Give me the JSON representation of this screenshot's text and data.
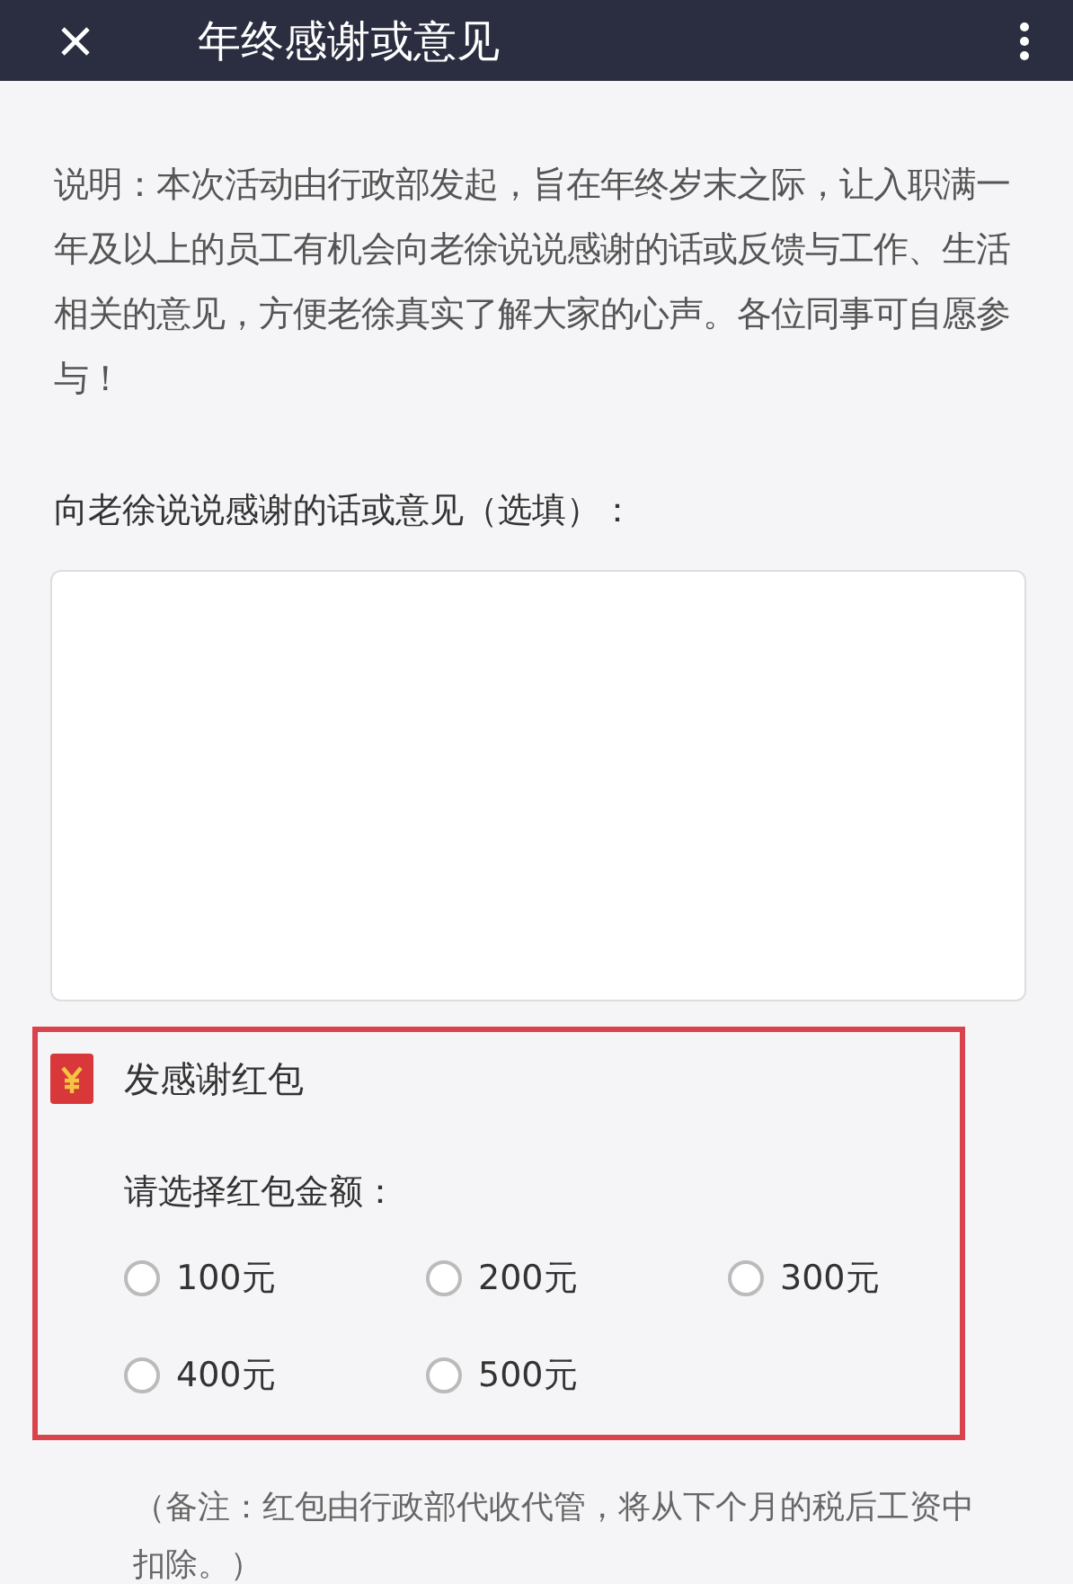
{
  "header": {
    "title": "年终感谢或意见"
  },
  "description": "说明：本次活动由行政部发起，旨在年终岁末之际，让入职满一年及以上的员工有机会向老徐说说感谢的话或反馈与工作、生活相关的意见，方便老徐真实了解大家的心声。各位同事可自愿参与！",
  "comment": {
    "label": "向老徐说说感谢的话或意见（选填）："
  },
  "red_packet": {
    "label": "发感谢红包",
    "prompt": "请选择红包金额：",
    "options": [
      {
        "label": "100元",
        "selected": false
      },
      {
        "label": "200元",
        "selected": false
      },
      {
        "label": "300元",
        "selected": false
      },
      {
        "label": "400元",
        "selected": false
      },
      {
        "label": "500元",
        "selected": false
      }
    ]
  },
  "note": "（备注：红包由行政部代收代管，将从下个月的税后工资中扣除。）"
}
